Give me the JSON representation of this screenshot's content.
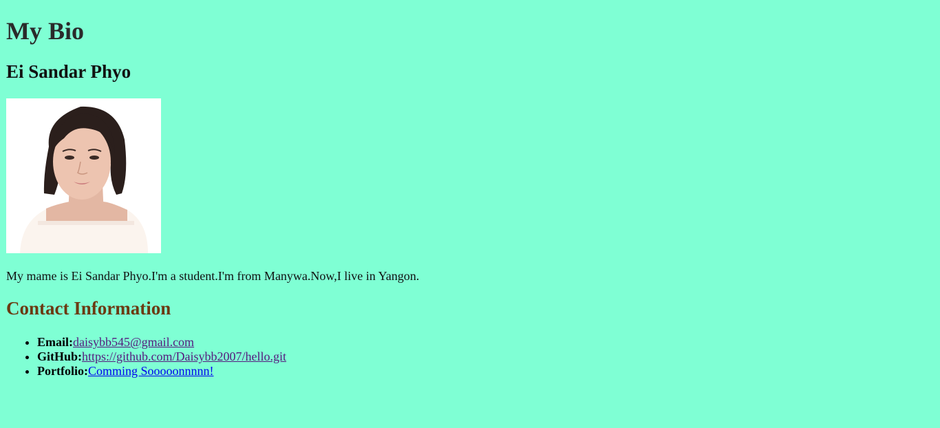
{
  "header": {
    "title": "My Bio",
    "name": "Ei Sandar Phyo"
  },
  "photo": {
    "alt": "Ei Sandar Phyo"
  },
  "intro": {
    "text": "My mame is Ei Sandar Phyo.I'm a student.I'm from Manywa.Now,I live in Yangon."
  },
  "contact": {
    "heading": "Contact Information",
    "items": [
      {
        "label": "Email:",
        "link_text": "daisybb545@gmail.com"
      },
      {
        "label": "GitHub:",
        "link_text": "https://github.com/Daisybb2007/hello.git"
      },
      {
        "label": "Portfolio:",
        "link_text": "Comming Sooooonnnnn!"
      }
    ]
  },
  "colors": {
    "background": "#7fffd4",
    "contact_heading": "#6b3a12",
    "visited_link": "#55197e",
    "link": "#0000ee"
  }
}
